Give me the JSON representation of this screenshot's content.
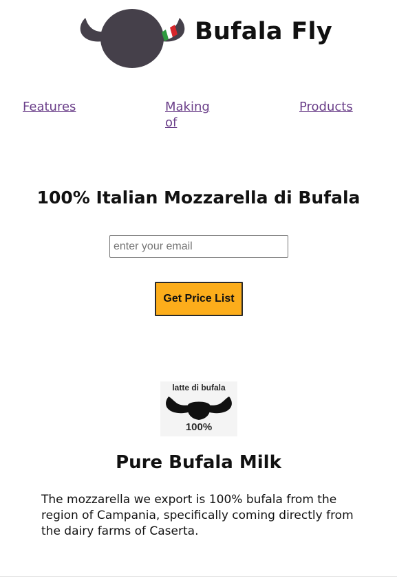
{
  "header": {
    "brand_name": "Bufala Fly",
    "logo_icon": "buffalo-head-logo",
    "flag_colors": [
      "#2e9a3e",
      "#ffffff",
      "#d7262b"
    ],
    "logo_color": "#45404a"
  },
  "nav": {
    "links": [
      {
        "label": "Features"
      },
      {
        "label": "Making of"
      },
      {
        "label": "Products"
      }
    ],
    "link_color": "#6a3e89"
  },
  "hero": {
    "title": "100% Italian Mozzarella di Bufala",
    "email_placeholder": "enter your email",
    "email_value": "",
    "submit_label": "Get Price List",
    "button_color": "#fcad1b"
  },
  "features": [
    {
      "icon": "latte-di-bufala-badge-icon",
      "badge_top": "latte di bufala",
      "badge_bottom": "100%",
      "title": "Pure Bufala Milk",
      "description": "The mozzarella we export is 100% bufala from the region of Campania, specifically coming directly from the dairy farms of Caserta."
    }
  ]
}
